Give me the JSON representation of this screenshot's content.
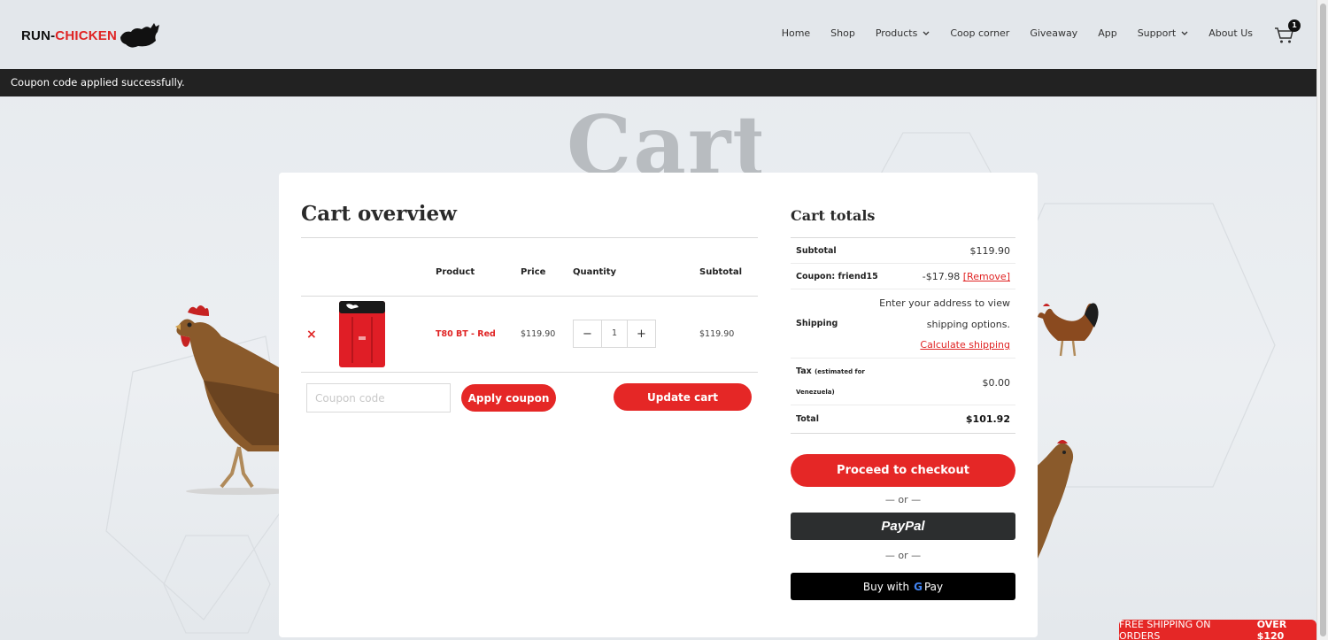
{
  "brand": {
    "part1": "RUN-",
    "part2": "CHICKEN"
  },
  "nav": {
    "items": [
      {
        "label": "Home",
        "dropdown": false
      },
      {
        "label": "Shop",
        "dropdown": false
      },
      {
        "label": "Products",
        "dropdown": true
      },
      {
        "label": "Coop corner",
        "dropdown": false
      },
      {
        "label": "Giveaway",
        "dropdown": false
      },
      {
        "label": "App",
        "dropdown": false
      },
      {
        "label": "Support",
        "dropdown": true
      },
      {
        "label": "About Us",
        "dropdown": false
      }
    ],
    "cart_count": "1"
  },
  "notice": "Coupon code applied successfully.",
  "hero_title": "Cart",
  "overview": {
    "title": "Cart overview",
    "columns": {
      "product": "Product",
      "price": "Price",
      "quantity": "Quantity",
      "subtotal": "Subtotal"
    },
    "row": {
      "remove": "×",
      "product": "T80 BT - Red",
      "price": "$119.90",
      "qty_minus": "−",
      "qty": "1",
      "qty_plus": "+",
      "subtotal": "$119.90"
    },
    "coupon_placeholder": "Coupon code",
    "apply_label": "Apply coupon",
    "update_label": "Update cart"
  },
  "totals": {
    "title": "Cart totals",
    "subtotal_label": "Subtotal",
    "subtotal_value": "$119.90",
    "coupon_label": "Coupon: friend15",
    "coupon_value": "-$17.98",
    "coupon_remove": "[Remove]",
    "shipping_label": "Shipping",
    "shipping_line1": "Enter your address to view",
    "shipping_line2": "shipping options.",
    "shipping_link": "Calculate shipping",
    "tax_label": "Tax",
    "tax_note1": "(estimated for",
    "tax_note2": "Venezuela)",
    "tax_value": "$0.00",
    "total_label": "Total",
    "total_value": "$101.92",
    "checkout_label": "Proceed to checkout",
    "or1": "— or —",
    "paypal_label": "PayPal",
    "or2": "— or —",
    "gpay_prefix": "Buy with",
    "gpay_g": "G",
    "gpay_pay": "Pay"
  },
  "free_shipping": {
    "text": "FREE SHIPPING ON ORDERS",
    "bold": "OVER $120"
  },
  "colors": {
    "accent": "#e52726",
    "dark": "#222222"
  }
}
